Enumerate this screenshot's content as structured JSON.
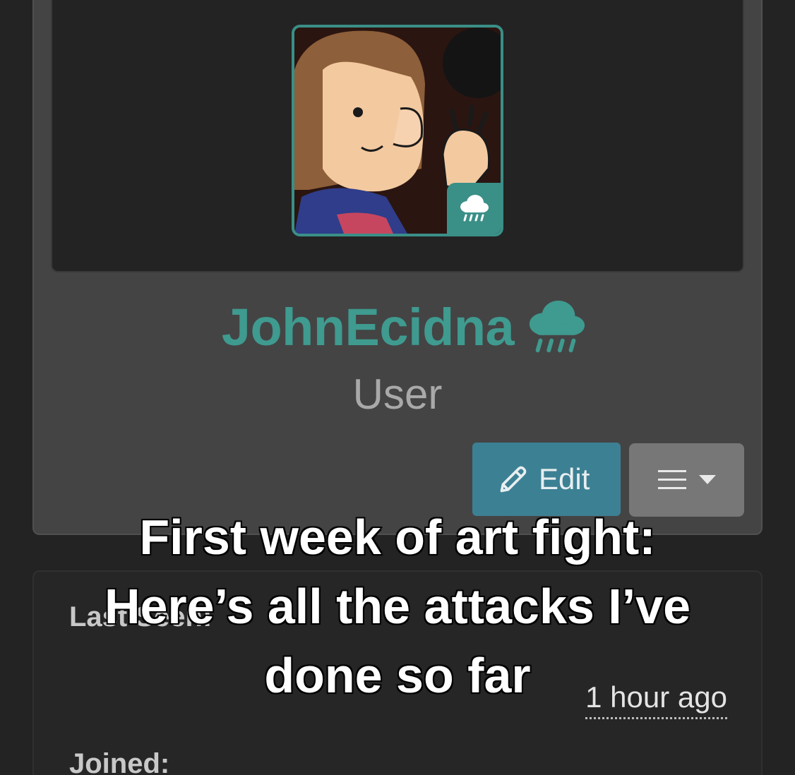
{
  "profile": {
    "username": "JohnEcidna",
    "rank": "User",
    "avatar_badge_icon": "rain-cloud-icon",
    "username_status_icon": "rain-cloud-icon",
    "accent_color": "#3f9a8f"
  },
  "actions": {
    "edit_label": "Edit",
    "edit_icon": "pencil-icon",
    "menu_icon": "hamburger-menu-icon"
  },
  "info": {
    "last_seen_label": "Last Seen:",
    "last_seen_value": "1 hour ago",
    "joined_label": "Joined:"
  },
  "caption": {
    "lines": [
      "First week of art fight:",
      "Here’s all the attacks I’ve",
      "done so far"
    ]
  }
}
